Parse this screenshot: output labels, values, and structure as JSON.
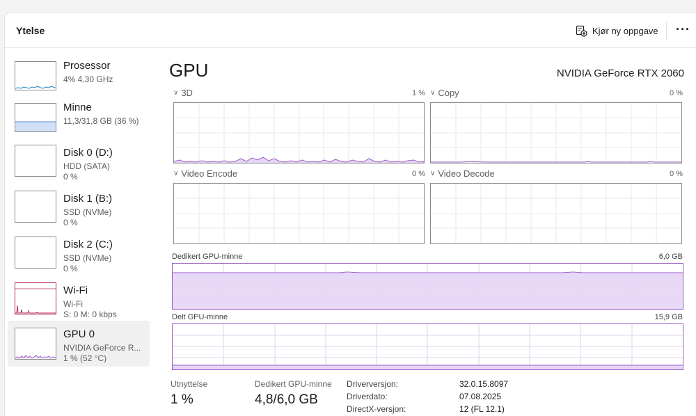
{
  "header": {
    "title": "Ytelse",
    "run_new_task": "Kjør ny oppgave",
    "more": "···"
  },
  "sidebar": {
    "items": [
      {
        "name": "Prosessor",
        "line1": "4% 4,30 GHz",
        "line2": ""
      },
      {
        "name": "Minne",
        "line1": "11,3/31,8 GB (36 %)",
        "line2": ""
      },
      {
        "name": "Disk 0 (D:)",
        "line1": "HDD (SATA)",
        "line2": "0 %"
      },
      {
        "name": "Disk 1 (B:)",
        "line1": "SSD (NVMe)",
        "line2": "0 %"
      },
      {
        "name": "Disk 2 (C:)",
        "line1": "SSD (NVMe)",
        "line2": "0 %"
      },
      {
        "name": "Wi-Fi",
        "line1": "Wi-Fi",
        "line2": "S: 0 M: 0 kbps"
      },
      {
        "name": "GPU 0",
        "line1": "NVIDIA GeForce R...",
        "line2": "1 % (52 °C)"
      }
    ]
  },
  "main": {
    "title": "GPU",
    "model": "NVIDIA GeForce RTX 2060",
    "engines": [
      {
        "label": "3D",
        "value": "1 %"
      },
      {
        "label": "Copy",
        "value": "0 %"
      },
      {
        "label": "Video Encode",
        "value": "0 %"
      },
      {
        "label": "Video Decode",
        "value": "0 %"
      }
    ],
    "dedicated_memory": {
      "label": "Dedikert GPU-minne",
      "max": "6,0 GB",
      "fraction": 0.8
    },
    "shared_memory": {
      "label": "Delt GPU-minne",
      "max": "15,9 GB",
      "fraction": 0.09
    }
  },
  "stats": {
    "utilization_label": "Utnyttelse",
    "utilization_value": "1 %",
    "dedicated_label": "Dedikert GPU-minne",
    "dedicated_value": "4,8/6,0 GB",
    "info": [
      {
        "label": "Driverversjon:",
        "value": "32.0.15.8097"
      },
      {
        "label": "Driverdato:",
        "value": "07.08.2025"
      },
      {
        "label": "DirectX-versjon:",
        "value": "12 (FL 12.1)"
      }
    ]
  },
  "colors": {
    "gpu_accent": "#9a5cc9",
    "gpu_fill": "#e6d6f5",
    "cpu_accent": "#1a7fbf",
    "memory_accent": "#5a8ad6",
    "memory_fill": "#cfe0f7",
    "wifi_accent": "#b3245b"
  }
}
